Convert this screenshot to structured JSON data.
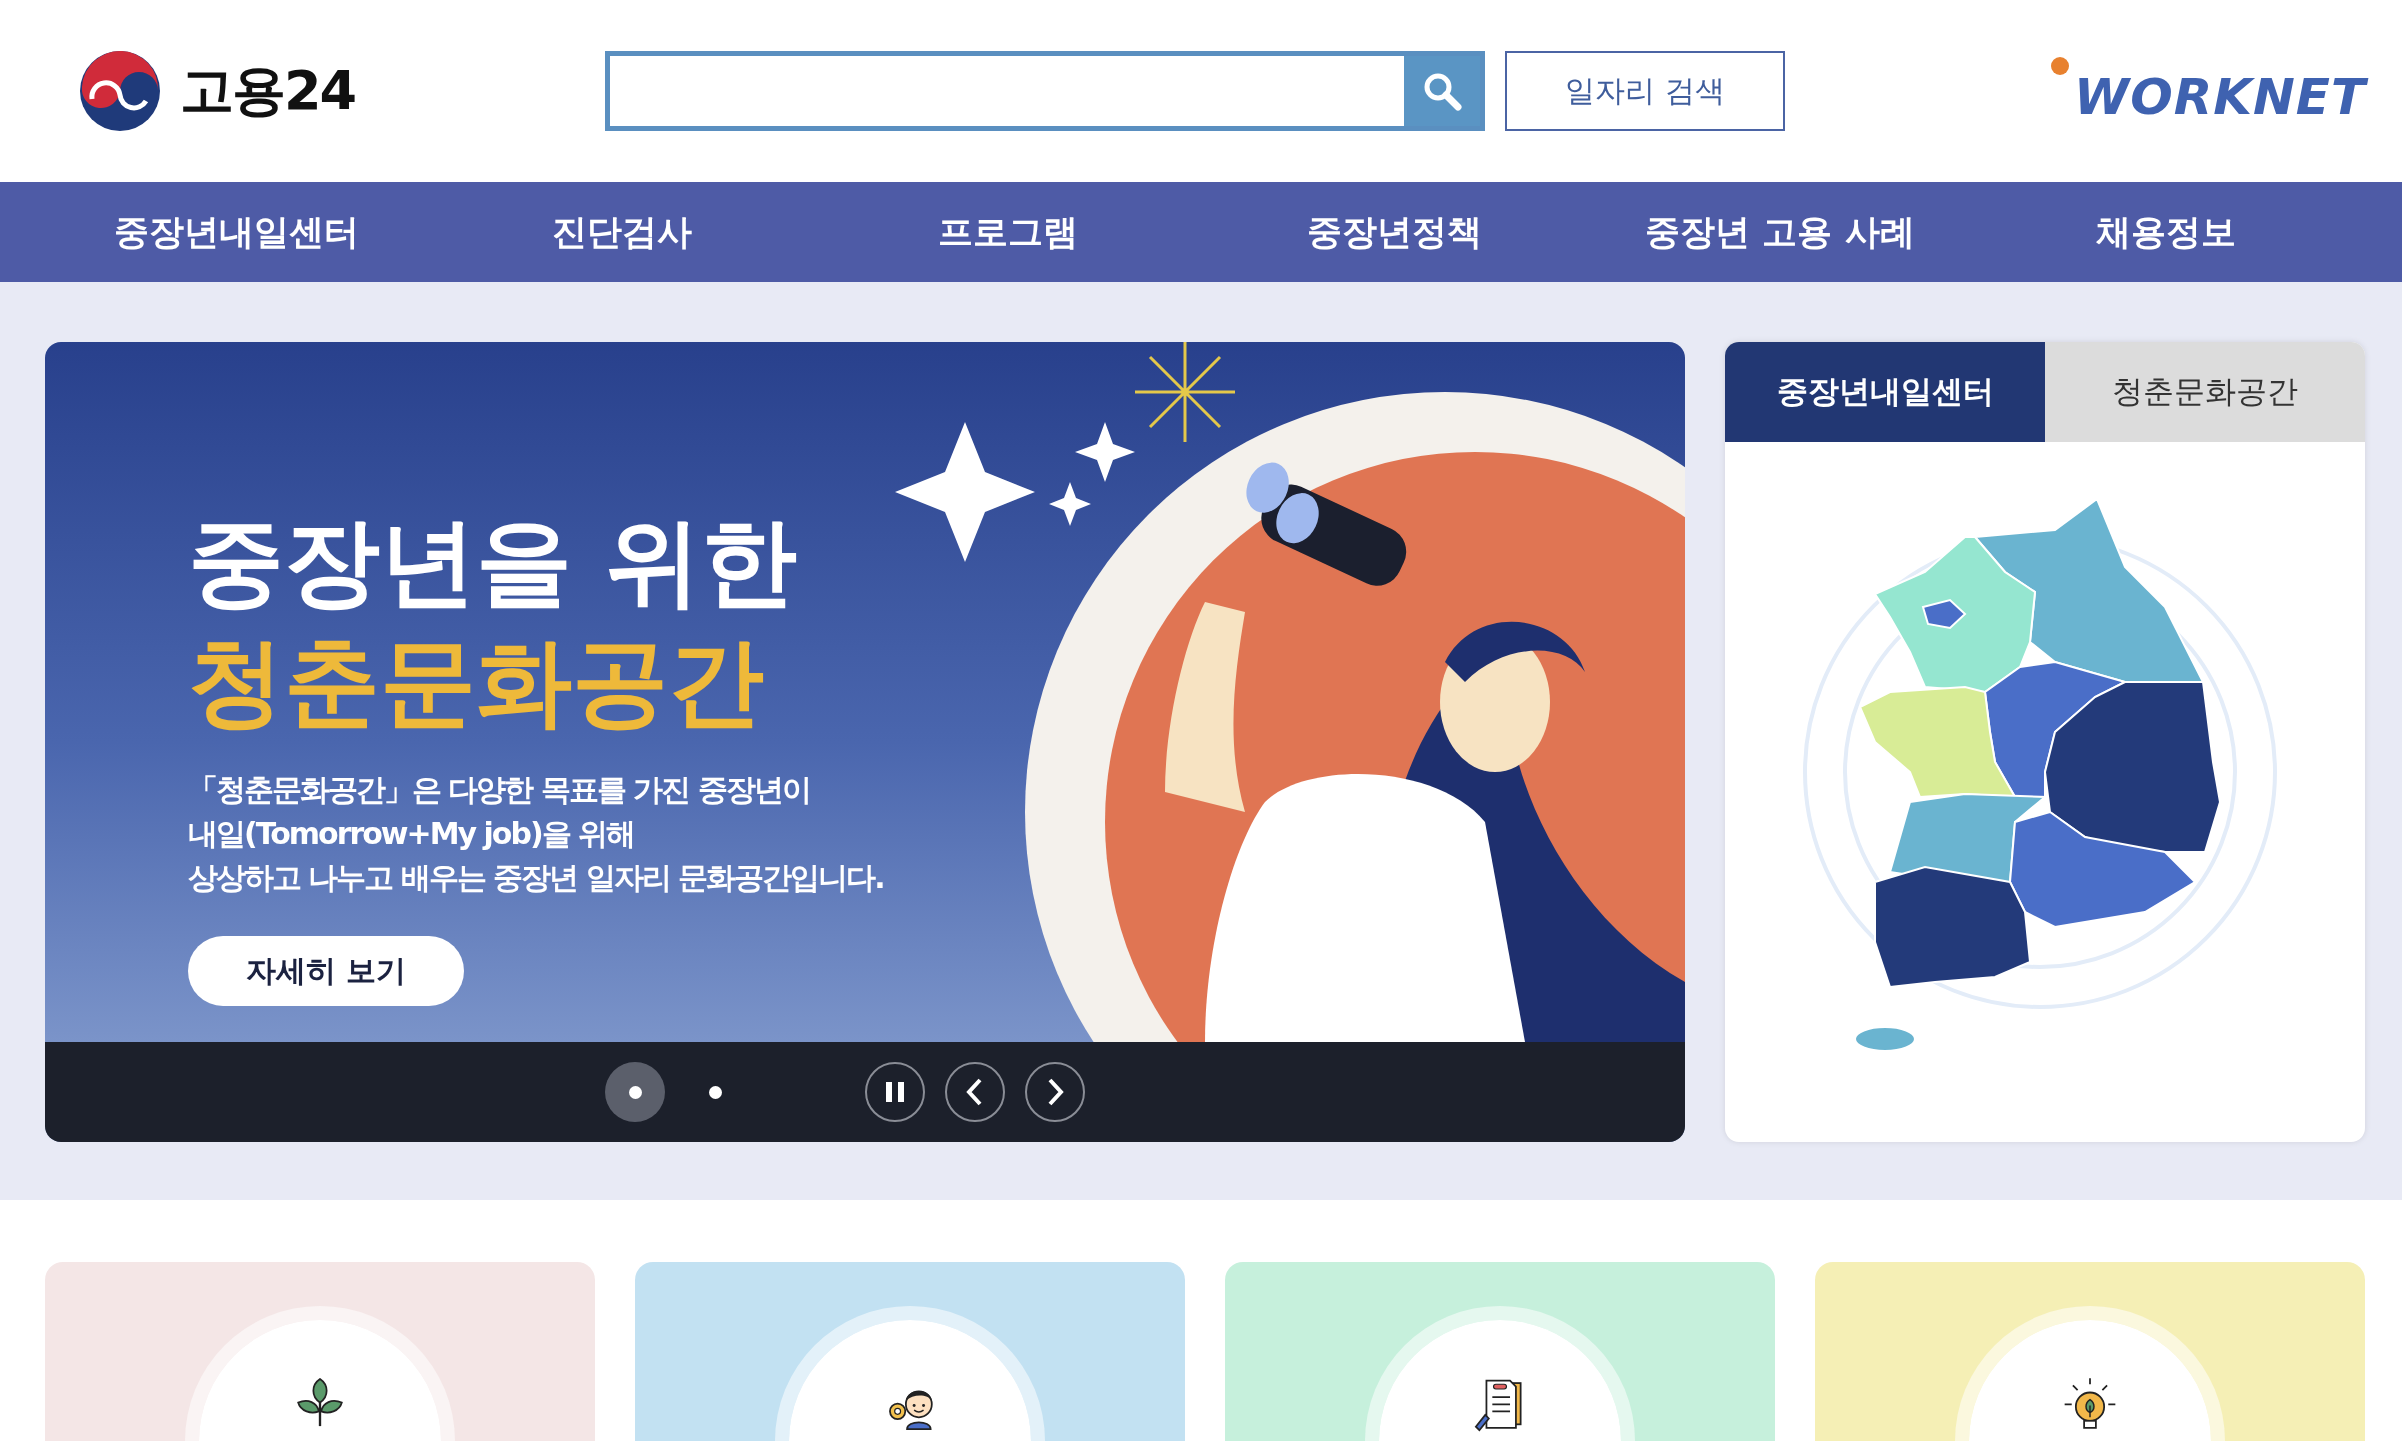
{
  "header": {
    "logo_text": "고용24",
    "job_search_button": "일자리 검색",
    "partner_logo": "WORKNET"
  },
  "nav": [
    "중장년내일센터",
    "진단검사",
    "프로그램",
    "중장년정책",
    "중장년 고용 사례",
    "채용정보"
  ],
  "banner": {
    "title_line_1": "중장년을 위한",
    "title_line_2": "청춘문화공간",
    "description_lines": [
      "「청춘문화공간」은 다양한 목표를 가진 중장년이",
      "내일(Tomorrow+My job)을 위해",
      "상상하고 나누고 배우는 중장년 일자리 문화공간입니다."
    ],
    "button": "자세히 보기",
    "slides": [
      {
        "selected": true
      },
      {
        "selected": false
      }
    ],
    "playing": true
  },
  "side_panel": {
    "tabs": [
      {
        "label": "중장년내일센터",
        "selected": true
      },
      {
        "label": "청춘문화공간",
        "selected": false
      }
    ]
  },
  "cards": [
    {
      "color": "#f4e6e6"
    },
    {
      "color": "#c2e1f2"
    },
    {
      "color": "#c6f0dc"
    },
    {
      "color": "#f5efb5"
    }
  ]
}
